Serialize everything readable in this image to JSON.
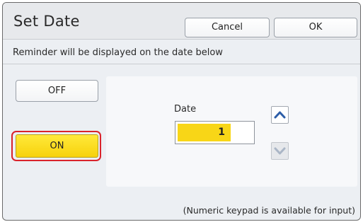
{
  "dialog": {
    "title": "Set Date",
    "cancel_label": "Cancel",
    "ok_label": "OK",
    "instruction": "Reminder will be displayed on the date below",
    "footnote": "(Numeric keypad is available for input)"
  },
  "toggle": {
    "off_label": "OFF",
    "on_label": "ON",
    "selected": "ON"
  },
  "date_picker": {
    "label": "Date",
    "value": "1",
    "up_icon": "chevron-up-icon",
    "down_icon": "chevron-down-icon"
  },
  "colors": {
    "accent": "#f7d20c",
    "highlight_ring": "#d9232b",
    "arrow_active": "#2d5ea8",
    "arrow_disabled": "#aab6c6"
  }
}
